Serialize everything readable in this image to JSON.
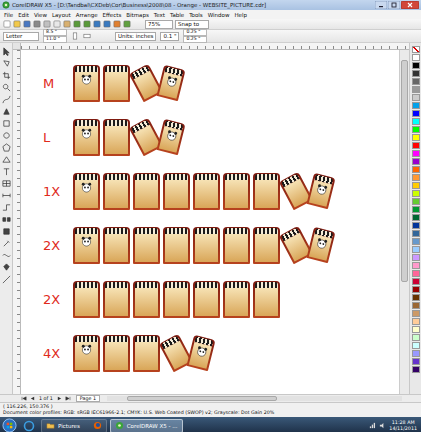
{
  "window": {
    "title": "CorelDRAW X5 - [D:\\Tandbal\\CXDeb\\Cor\\Business\\2008\\08 - Orange - WEBSITE_PICTURE.cdr]"
  },
  "menu": [
    "File",
    "Edit",
    "View",
    "Layout",
    "Arrange",
    "Effects",
    "Bitmaps",
    "Text",
    "Table",
    "Tools",
    "Window",
    "Help"
  ],
  "toolbar": {
    "zoom": "75%",
    "snap": "Snap to"
  },
  "property_bar": {
    "page_size": "Letter",
    "width": "8.5 \"",
    "height": "11.0 \"",
    "units": "Units: inches",
    "nudge": "0.1 \"",
    "dup_x": "0.25 \"",
    "dup_y": "0.25 \""
  },
  "rows": [
    {
      "label": "M",
      "items": [
        {
          "kind": "face"
        },
        {
          "kind": "plain"
        },
        {
          "kind": "flat"
        }
      ]
    },
    {
      "label": "L",
      "items": [
        {
          "kind": "face"
        },
        {
          "kind": "plain"
        },
        {
          "kind": "flat"
        }
      ]
    },
    {
      "label": "1X",
      "items": [
        {
          "kind": "face"
        },
        {
          "kind": "plain"
        },
        {
          "kind": "plain"
        },
        {
          "kind": "plain"
        },
        {
          "kind": "plain"
        },
        {
          "kind": "plain"
        },
        {
          "kind": "plain"
        },
        {
          "kind": "flat"
        }
      ]
    },
    {
      "label": "2X",
      "items": [
        {
          "kind": "face"
        },
        {
          "kind": "plain"
        },
        {
          "kind": "plain"
        },
        {
          "kind": "plain"
        },
        {
          "kind": "plain"
        },
        {
          "kind": "plain"
        },
        {
          "kind": "plain"
        },
        {
          "kind": "flat"
        }
      ]
    },
    {
      "label": "2X",
      "items": [
        {
          "kind": "plain"
        },
        {
          "kind": "plain"
        },
        {
          "kind": "plain"
        },
        {
          "kind": "plain"
        },
        {
          "kind": "plain"
        },
        {
          "kind": "plain"
        },
        {
          "kind": "plain"
        }
      ]
    },
    {
      "label": "4X",
      "items": [
        {
          "kind": "face"
        },
        {
          "kind": "plain"
        },
        {
          "kind": "plain"
        },
        {
          "kind": "flat"
        }
      ]
    }
  ],
  "palette": [
    {
      "color": "#ffffff"
    },
    {
      "color": "#000000"
    },
    {
      "color": "#333333"
    },
    {
      "color": "#666666"
    },
    {
      "color": "#999999"
    },
    {
      "color": "#cccccc"
    },
    {
      "color": "#00a0e9"
    },
    {
      "color": "#0000ff"
    },
    {
      "color": "#00ffff"
    },
    {
      "color": "#00ff00"
    },
    {
      "color": "#ffff00"
    },
    {
      "color": "#ff0000"
    },
    {
      "color": "#ff00ff"
    },
    {
      "color": "#9900cc"
    },
    {
      "color": "#ff6600"
    },
    {
      "color": "#ff9933"
    },
    {
      "color": "#ffcc00"
    },
    {
      "color": "#ccff00"
    },
    {
      "color": "#66cc33"
    },
    {
      "color": "#009933"
    },
    {
      "color": "#006633"
    },
    {
      "color": "#003399"
    },
    {
      "color": "#336699"
    },
    {
      "color": "#6699cc"
    },
    {
      "color": "#99ccff"
    },
    {
      "color": "#cc99ff"
    },
    {
      "color": "#ff99cc"
    },
    {
      "color": "#ff6699"
    },
    {
      "color": "#cc0033"
    },
    {
      "color": "#990000"
    },
    {
      "color": "#663300"
    },
    {
      "color": "#996633"
    },
    {
      "color": "#cc9966"
    },
    {
      "color": "#ffcc99"
    },
    {
      "color": "#ffffcc"
    },
    {
      "color": "#ccffcc"
    },
    {
      "color": "#ccffff"
    },
    {
      "color": "#9999ff"
    },
    {
      "color": "#6633cc"
    },
    {
      "color": "#330066"
    }
  ],
  "page_nav": {
    "count": "1 of 1",
    "tab": "Page 1"
  },
  "status": {
    "coords": "( 116.226, 150.376 )",
    "profile": "Document color profiles: RGB: sRGB IEC61966-2.1; CMYK: U.S. Web Coated (SWOP) v2; Grayscale: Dot Gain 20%"
  },
  "taskbar": {
    "items": [
      {
        "label": "Pictures",
        "selected": false
      },
      {
        "label": "CorelDRAW X5 - ...",
        "selected": true
      }
    ],
    "time": "11:28 AM",
    "date": "14/11/2011"
  }
}
